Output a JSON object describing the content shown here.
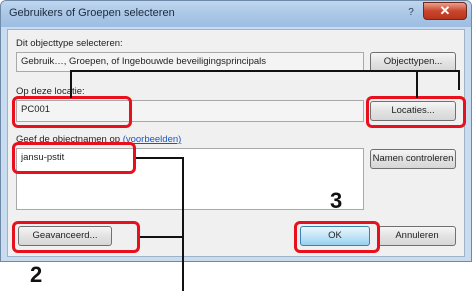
{
  "window": {
    "title": "Gebruikers of Groepen selecteren",
    "help_glyph": "?",
    "close_glyph": "✕"
  },
  "dialog": {
    "object_type_label": "Dit objecttype selecteren:",
    "object_type_value": "Gebruik…, Groepen, of Ingebouwde beveiligingsprincipals",
    "object_types_button": "Objecttypen...",
    "location_label": "Op deze locatie:",
    "location_value": "PC001",
    "locations_button": "Locaties...",
    "names_label_prefix": "Geef de objectnamen op",
    "names_label_link": "(voorbeelden)",
    "names_value": "jansu-pstit",
    "check_names_button": "Namen controleren",
    "advanced_button": "Geavanceerd...",
    "ok_button": "OK",
    "cancel_button": "Annuleren"
  },
  "annotations": {
    "step_2": "2",
    "step_3": "3",
    "highlight_color": "#e8101c"
  }
}
